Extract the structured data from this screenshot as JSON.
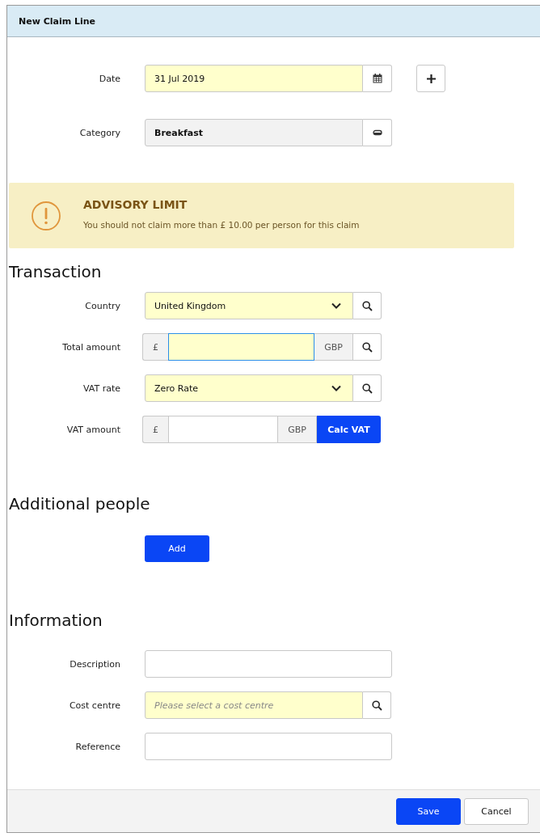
{
  "dialog": {
    "title": "New Claim Line"
  },
  "top_fields": [
    {
      "kind": "date",
      "label": "Date",
      "value": "31 Jul 2019",
      "required": true,
      "add_button": true
    },
    {
      "kind": "category",
      "label": "Category",
      "value": "Breakfast",
      "required": false
    }
  ],
  "advisory": {
    "title": "ADVISORY LIMIT",
    "message": "You should not claim more than £ 10.00 per person for this claim"
  },
  "transaction": {
    "heading": "Transaction",
    "fields": [
      {
        "kind": "select",
        "label": "Country",
        "value": "United Kingdom",
        "required": true,
        "addon": {
          "kind": "search"
        }
      },
      {
        "kind": "currency",
        "label": "Total amount",
        "prefix": "£",
        "suffix": "GBP",
        "required": true,
        "focused": true,
        "addon": {
          "kind": "search"
        }
      },
      {
        "kind": "select",
        "label": "VAT rate",
        "value": "Zero Rate",
        "required": true,
        "addon": {
          "kind": "search"
        }
      },
      {
        "kind": "currency",
        "label": "VAT amount",
        "prefix": "£",
        "suffix": "GBP",
        "required": false,
        "focused": false,
        "addon": {
          "kind": "button",
          "label": "Calc VAT"
        }
      }
    ]
  },
  "additional_people": {
    "heading": "Additional people",
    "button": "Add"
  },
  "information": {
    "heading": "Information",
    "fields": [
      {
        "kind": "text",
        "label": "Description",
        "required": false
      },
      {
        "kind": "lookup",
        "label": "Cost centre",
        "placeholder": "Please select a cost centre",
        "required": true,
        "addon": {
          "kind": "search"
        }
      },
      {
        "kind": "text",
        "label": "Reference",
        "required": false
      }
    ]
  },
  "footer": {
    "buttons": [
      {
        "label": "Save",
        "primary": true
      },
      {
        "label": "Cancel",
        "primary": false
      }
    ]
  }
}
